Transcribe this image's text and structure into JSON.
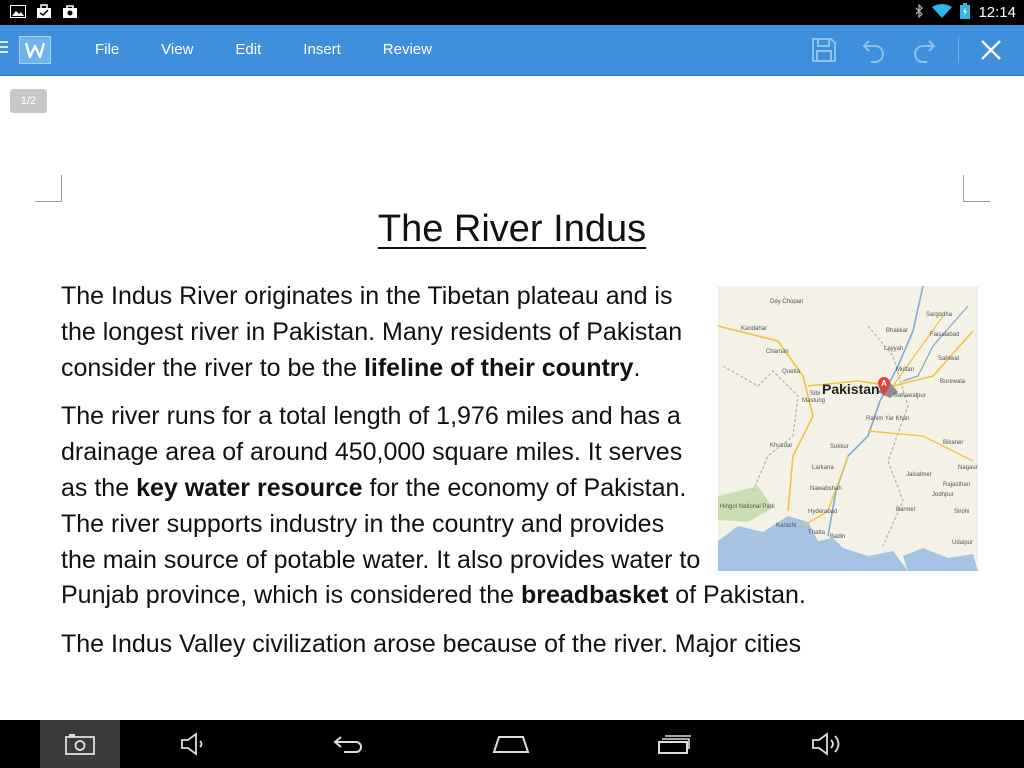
{
  "status_bar": {
    "time": "12:14",
    "left_icons": [
      "gallery-icon",
      "briefcase-icon",
      "shopping-bag-icon"
    ],
    "right_icons": [
      "bluetooth-icon",
      "wifi-icon",
      "battery-charging-icon"
    ]
  },
  "toolbar": {
    "logo_icon": "wps-writer-logo-icon",
    "menu_items": [
      "File",
      "View",
      "Edit",
      "Insert",
      "Review"
    ],
    "actions": [
      "save-icon",
      "undo-icon",
      "redo-icon",
      "close-icon"
    ],
    "background_color": "#3f8fdc"
  },
  "document": {
    "page_indicator": "1/2",
    "title": "The River Indus",
    "paragraphs": [
      {
        "segments": [
          {
            "text": "The Indus River originates in the Tibetan plateau and is the longest river in Pakistan. Many residents of Pakistan consider the river to be the ",
            "bold": false
          },
          {
            "text": "lifeline of their country",
            "bold": true
          },
          {
            "text": ".",
            "bold": false
          }
        ]
      },
      {
        "segments": [
          {
            "text": "The river runs for a total length of 1,976 miles and has a drainage area of around 450,000 square miles. It serves as the ",
            "bold": false
          },
          {
            "text": "key water resource",
            "bold": true
          },
          {
            "text": " for the economy of Pakistan. The river supports industry in the country and provides the main source of potable water. It also provides water to Punjab province, which is considered the ",
            "bold": false
          },
          {
            "text": "breadbasket",
            "bold": true
          },
          {
            "text": " of Pakistan.",
            "bold": false
          }
        ]
      },
      {
        "segments": [
          {
            "text": "The Indus Valley civilization arose because of the river. Major cities",
            "bold": false
          }
        ]
      }
    ],
    "map": {
      "main_label": "Pakistan",
      "marker_letter": "A",
      "city_labels": [
        "Dey Chopan",
        "Kandahar",
        "Chaman",
        "Quetta",
        "Sibi",
        "Sargodha",
        "Faisalabad",
        "Bhakkar",
        "Layyah",
        "Sahiwal",
        "Multan",
        "Bahawalpur",
        "Burewala",
        "Rahim Yar Khan",
        "Mastung",
        "Khuzdar",
        "Sukkur",
        "Larkana",
        "Bikaner",
        "Nagaur",
        "Jaisalmer",
        "Jodhpur",
        "Rajasthan",
        "Nawabshah",
        "Hyderabad",
        "Karachi",
        "Thatta",
        "Badin",
        "Barmer",
        "Sirohi",
        "Udaipur",
        "Hingol National Park"
      ],
      "land_color": "#f4f1e6",
      "water_color": "#a7c3e4",
      "park_color": "#c9deb4",
      "road_color": "#f3c33f",
      "marker_color": "#e0433b"
    }
  },
  "navigation": {
    "buttons": [
      "screenshot-icon",
      "volume-down-icon",
      "back-icon",
      "home-icon",
      "recent-apps-icon",
      "volume-up-icon"
    ]
  }
}
